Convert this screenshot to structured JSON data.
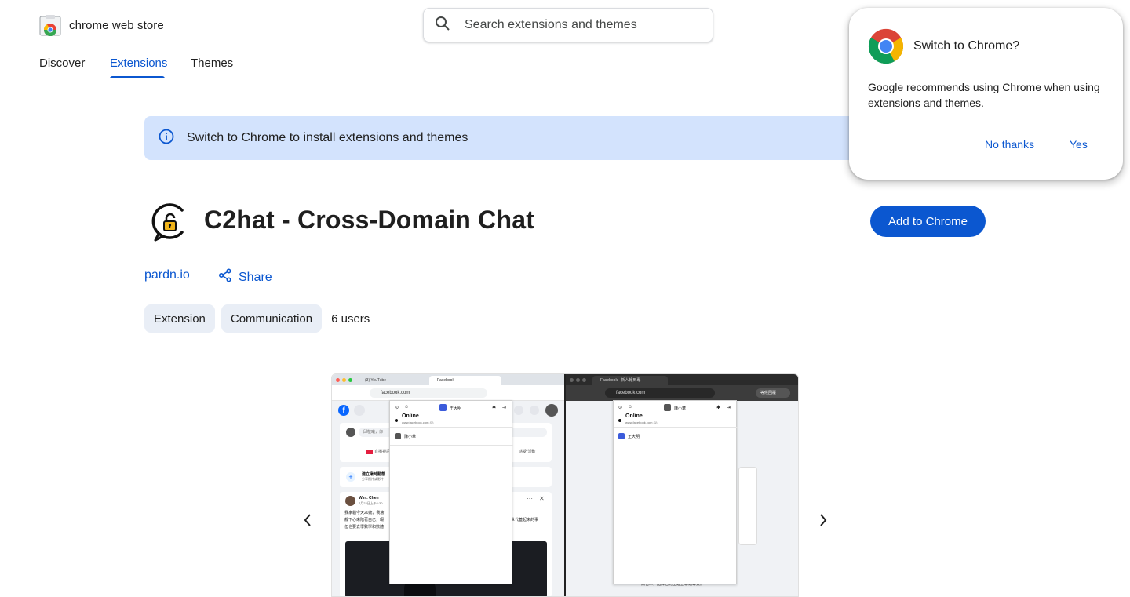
{
  "header": {
    "brand": "chrome web store",
    "search_placeholder": "Search extensions and themes"
  },
  "nav": {
    "items": [
      {
        "label": "Discover",
        "active": false
      },
      {
        "label": "Extensions",
        "active": true
      },
      {
        "label": "Themes",
        "active": false
      }
    ]
  },
  "banner": {
    "text": "Switch to Chrome to install extensions and themes"
  },
  "extension": {
    "title": "C2hat - Cross-Domain Chat",
    "add_button": "Add to Chrome",
    "publisher": "pardn.io",
    "share_label": "Share",
    "chips": [
      "Extension",
      "Communication"
    ],
    "users": "6 users"
  },
  "screenshot": {
    "left": {
      "tabs": [
        "(3) YouTube",
        "Facebook"
      ],
      "url": "facebook.com",
      "popup_header_name": "王大明",
      "popup_status": "Online",
      "popup_status_sub": "www.facebook.com (1)",
      "popup_user": "陳小華",
      "composer_placeholder": "邱敬曦，你",
      "composer_actions": [
        "直播視訊",
        "感受/活動"
      ],
      "room_title": "建立揪時動態",
      "room_sub": "分享照片或影片",
      "post_author": "W.m. Chen",
      "post_time": "7月23日上午6:30",
      "post_lines": [
        "我家貓今天20歲，我會",
        "靜下心來陪著自己，暇",
        "但也要去學數學和數體"
      ],
      "post_line_right": "世代蓋起來的事"
    },
    "right": {
      "tabs": [
        "Facebook · 新人報到專"
      ],
      "url": "facebook.com",
      "badge": "等候回覆",
      "popup_header_name": "陳小華",
      "popup_status": "Online",
      "popup_status_sub": "www.facebook.com (1)",
      "popup_user": "王大明",
      "footer_text": "高名人，品牌店兒全建立聯絡專頁。"
    }
  },
  "dialog": {
    "title": "Switch to Chrome?",
    "body": "Google recommends using Chrome when using extensions and themes.",
    "no_label": "No thanks",
    "yes_label": "Yes"
  },
  "colors": {
    "accent": "#0b57d0",
    "banner_bg": "#d3e3fd",
    "chip_bg": "#e9eef6"
  }
}
